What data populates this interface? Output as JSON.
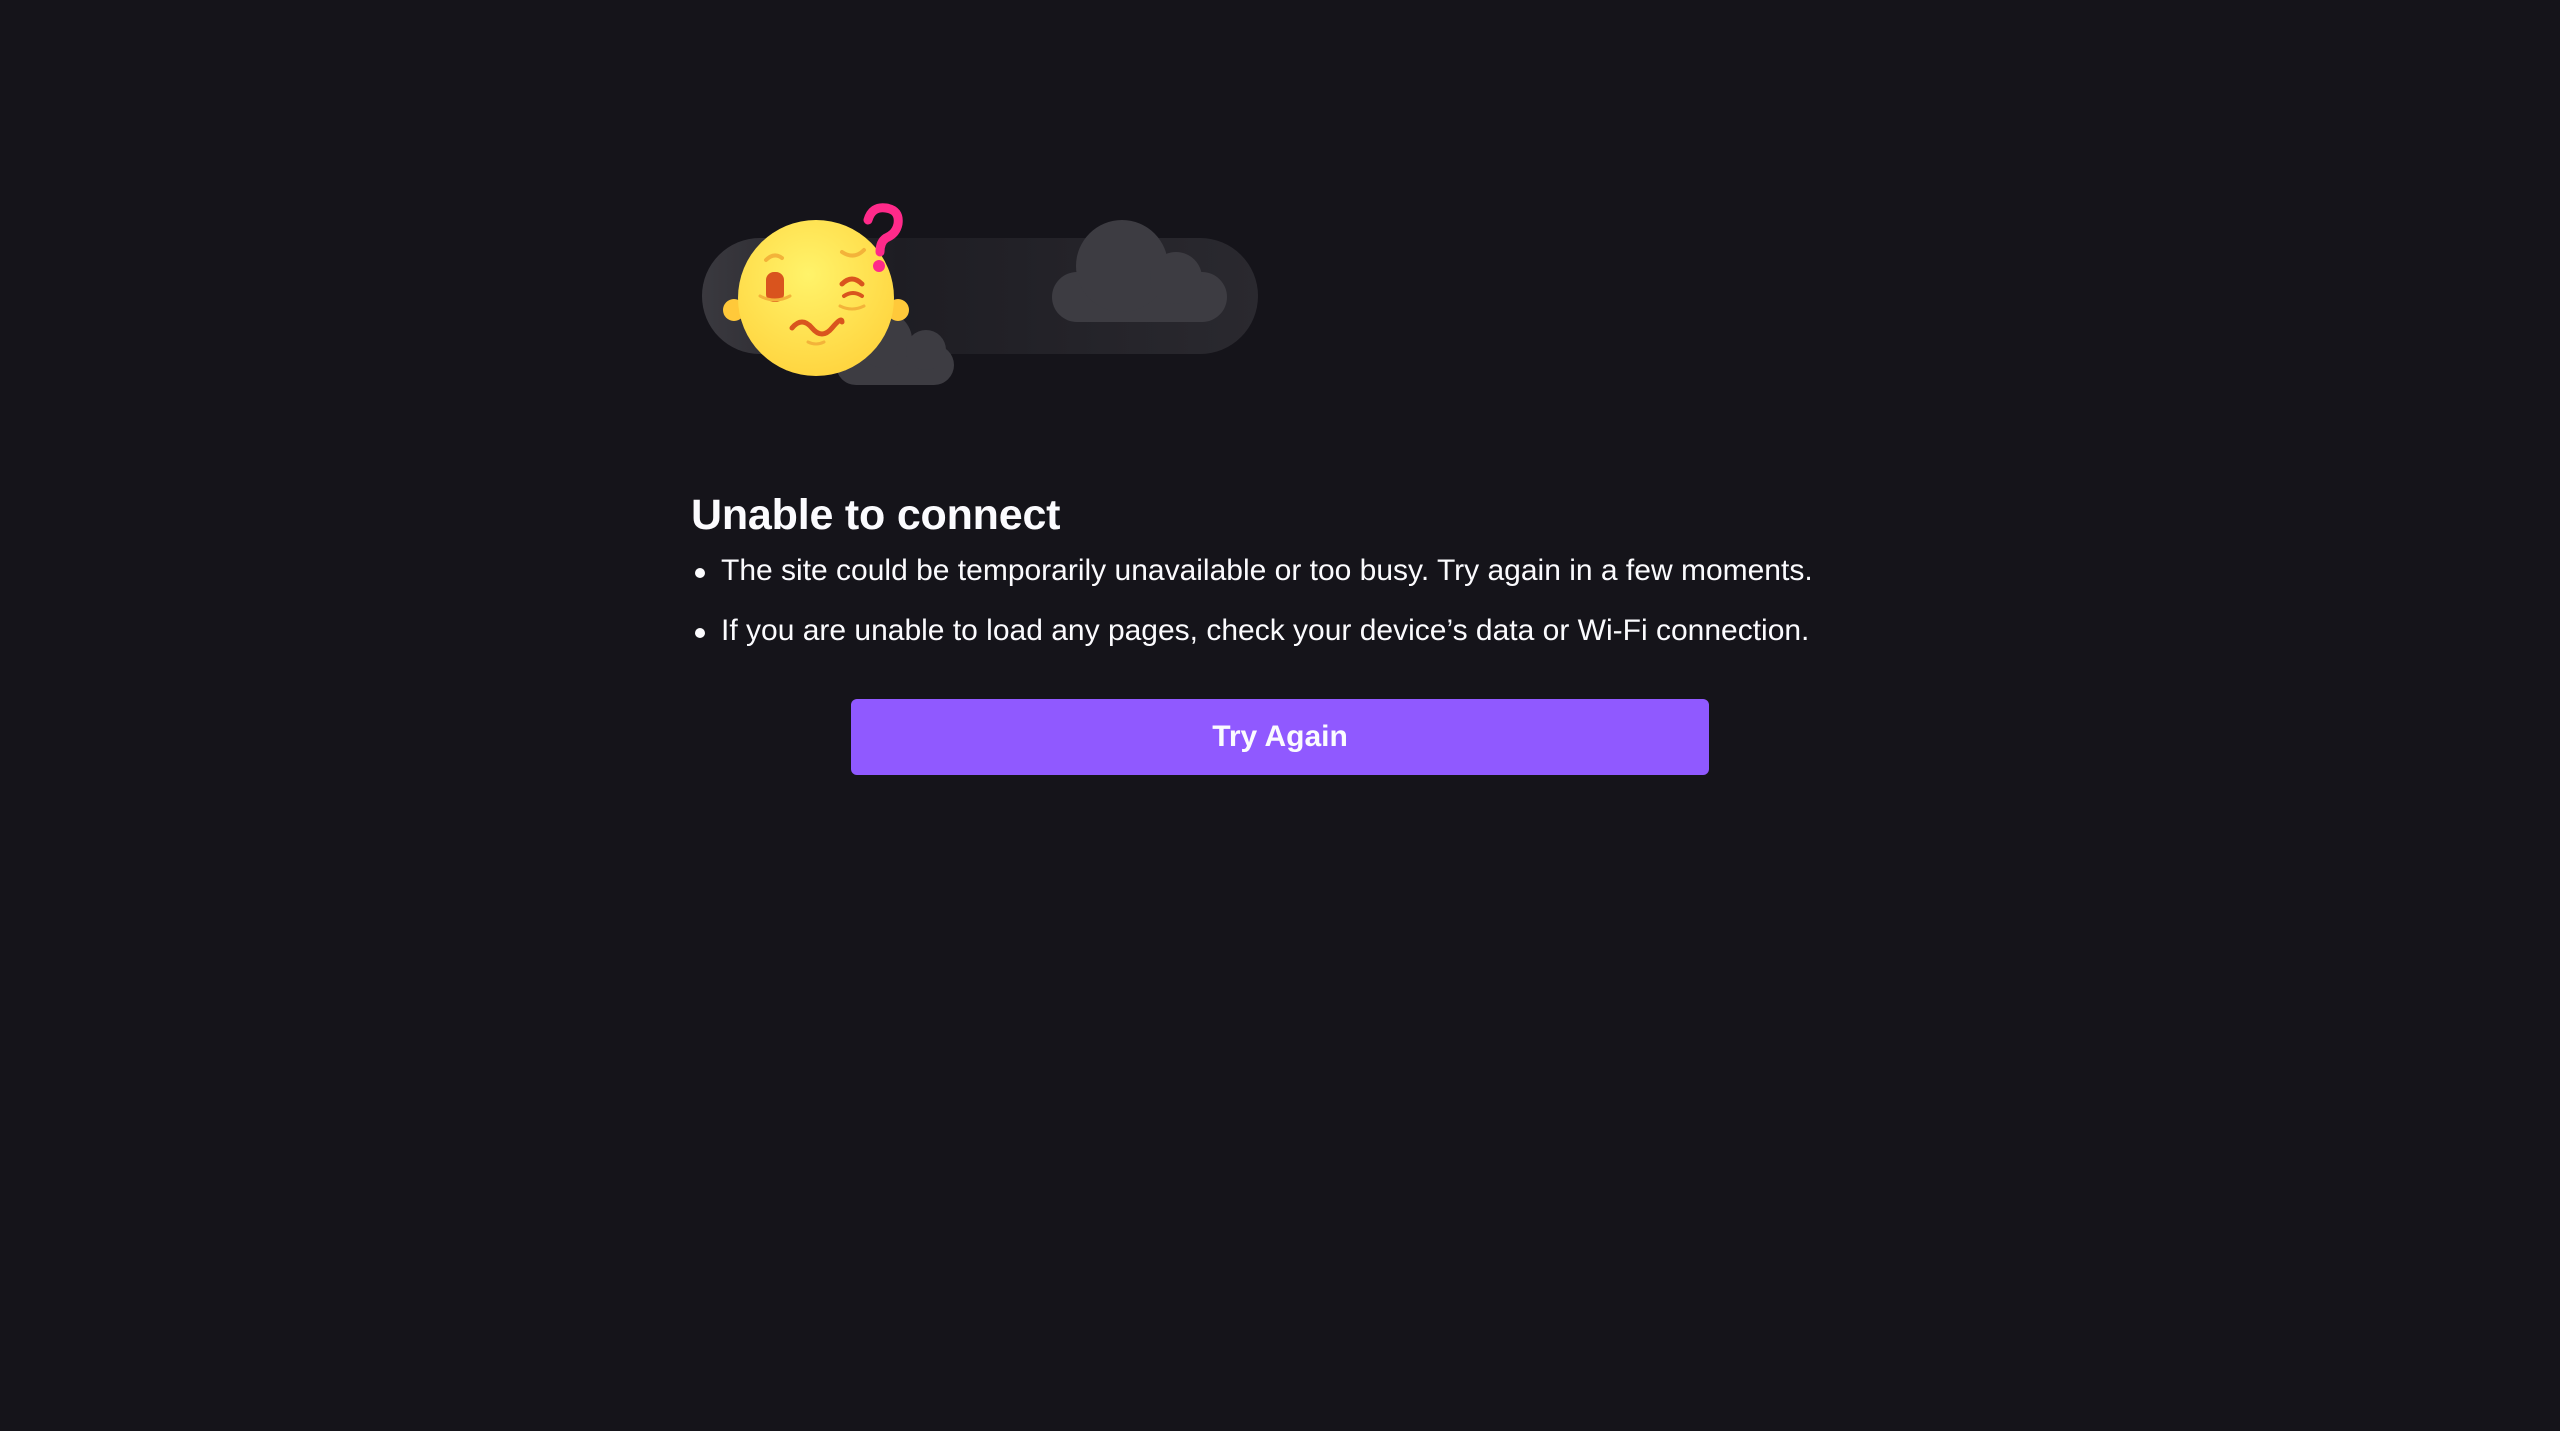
{
  "error": {
    "title": "Unable to connect",
    "bullets": [
      "The site could be temporarily unavailable or too busy. Try again in a few moments.",
      "If you are unable to load any pages, check your device’s data or Wi-Fi connection."
    ],
    "button_label": "Try Again"
  },
  "illustration": {
    "icon": "confused-face-with-clouds-icon",
    "question_mark": "?"
  },
  "colors": {
    "background": "#15141a",
    "text": "#fbfbfe",
    "accent_button": "#9059ff",
    "face": "#ffe34f",
    "question_mark": "#ff2a8a"
  }
}
